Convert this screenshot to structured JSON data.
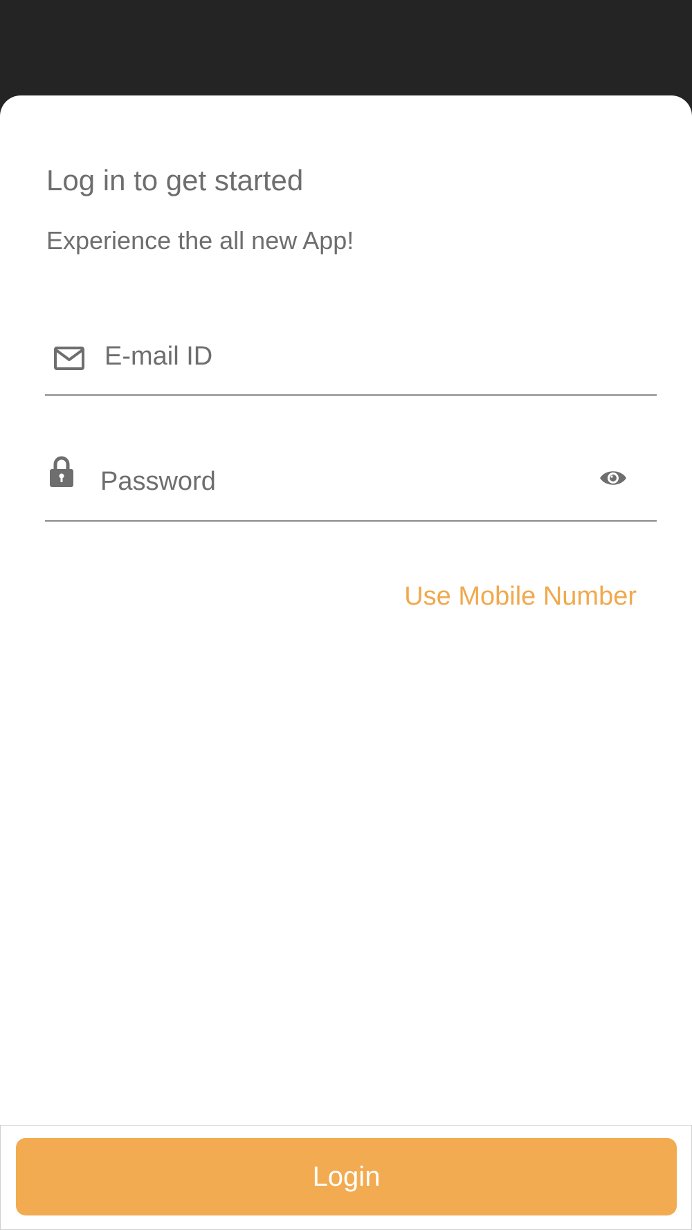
{
  "colors": {
    "top_bar": "#242424",
    "sheet_background": "#ffffff",
    "text_gray": "#6e6e6e",
    "accent_orange": "#f2ab50",
    "link_orange": "#f0a94d",
    "divider": "#8a8a8a"
  },
  "header": {
    "title": "Log in to get started",
    "subtitle": "Experience the all new App!"
  },
  "form": {
    "email": {
      "icon": "mail-icon",
      "placeholder": "E-mail ID",
      "value": ""
    },
    "password": {
      "icon": "lock-icon",
      "placeholder": "Password",
      "value": "",
      "toggle_icon": "eye-icon"
    }
  },
  "links": {
    "use_mobile": "Use Mobile Number"
  },
  "footer": {
    "login_label": "Login"
  }
}
